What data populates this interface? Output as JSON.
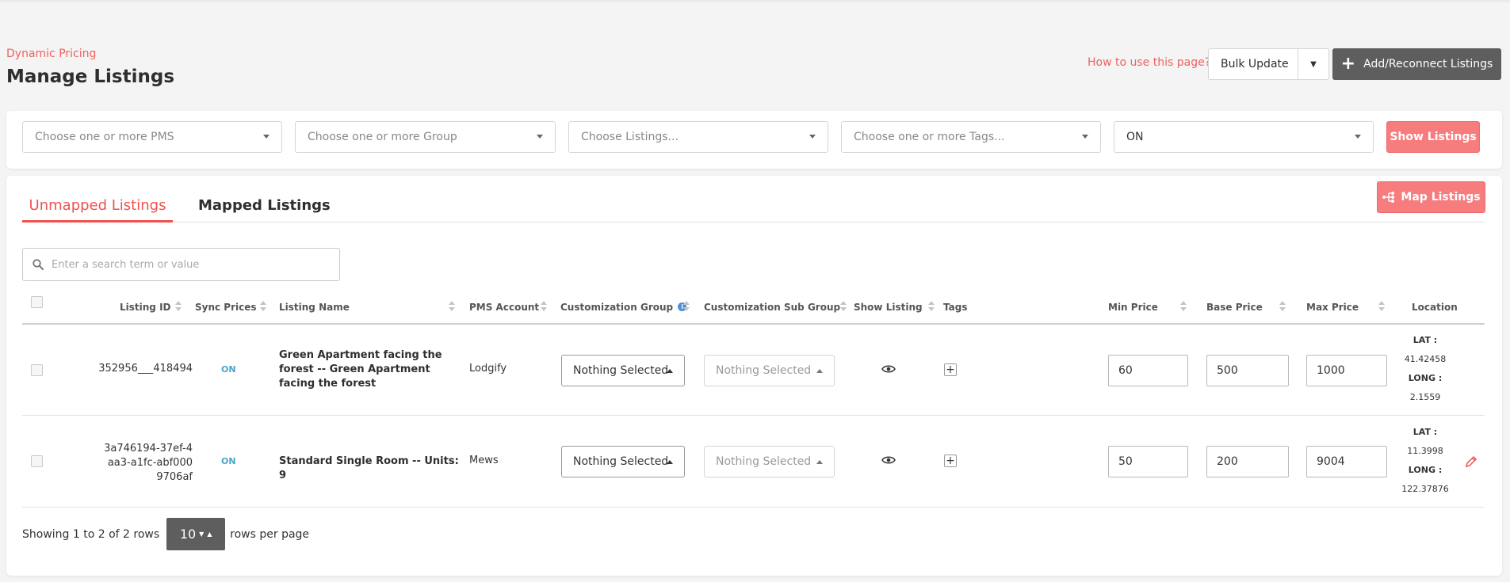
{
  "header": {
    "breadcrumb": "Dynamic Pricing",
    "title": "Manage Listings",
    "help_link": "How to use this page?",
    "bulk_update": "Bulk Update",
    "add_reconnect": "Add/Reconnect Listings"
  },
  "filters": {
    "pms_placeholder": "Choose one or more PMS",
    "group_placeholder": "Choose one or more Group",
    "listings_placeholder": "Choose Listings...",
    "tags_placeholder": "Choose one or more Tags...",
    "status_value": "ON",
    "show_listings": "Show Listings"
  },
  "tabs": {
    "unmapped": "Unmapped Listings",
    "mapped": "Mapped Listings",
    "map_listings": "Map Listings"
  },
  "search": {
    "placeholder": "Enter a search term or value"
  },
  "table": {
    "columns": {
      "listing_id": "Listing ID",
      "sync_prices": "Sync Prices",
      "listing_name": "Listing Name",
      "pms_account": "PMS Account",
      "customization_group": "Customization Group",
      "customization_sub_group": "Customization Sub Group",
      "show_listing": "Show Listing",
      "tags": "Tags",
      "min_price": "Min Price",
      "base_price": "Base Price",
      "max_price": "Max Price",
      "location": "Location"
    },
    "rows": [
      {
        "listing_id": "352956___418494",
        "sync": "ON",
        "name": "Green Apartment facing the forest -- Green Apartment facing the forest",
        "pms": "Lodgify",
        "group": "Nothing Selected",
        "sub_group": "Nothing Selected",
        "min_price": "60",
        "base_price": "500",
        "max_price": "1000",
        "lat_label": "LAT :",
        "lat": "41.42458",
        "long_label": "LONG :",
        "long": "2.1559"
      },
      {
        "listing_id": "3a746194-37ef-4aa3-a1fc-abf0009706af",
        "sync": "ON",
        "name": "Standard Single Room -- Units: 9",
        "pms": "Mews",
        "group": "Nothing Selected",
        "sub_group": "Nothing Selected",
        "min_price": "50",
        "base_price": "200",
        "max_price": "9004",
        "lat_label": "LAT :",
        "lat": "11.3998",
        "long_label": "LONG :",
        "long": "122.37876"
      }
    ]
  },
  "pagination": {
    "showing": "Showing 1 to 2 of 2 rows",
    "per_page_value": "10",
    "rows_per_page": "rows per page"
  },
  "colors": {
    "accent": "#ef5050",
    "button_red": "#f77c7e",
    "dark_button": "#5e5e5e",
    "sync_on": "#4aa3c9"
  }
}
